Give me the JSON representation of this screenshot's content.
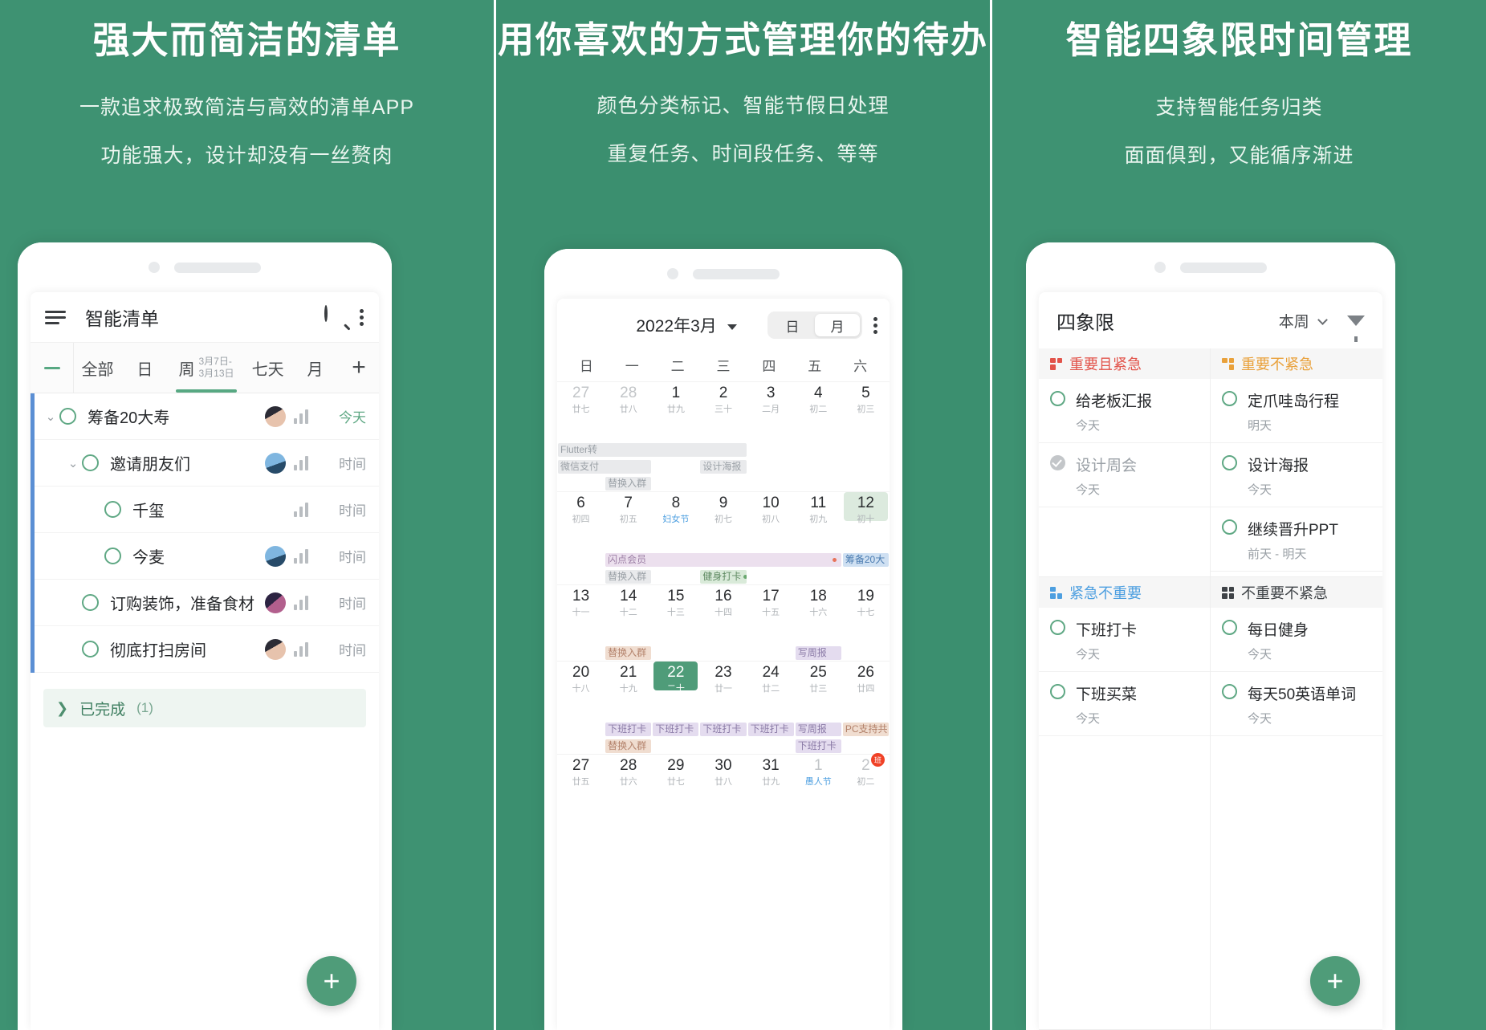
{
  "panels": [
    {
      "headline": "强大而简洁的清单",
      "sub1": "一款追求极致简洁与高效的清单APP",
      "sub2": "功能强大，设计却没有一丝赘肉"
    },
    {
      "headline": "用你喜欢的方式管理你的待办",
      "sub1": "颜色分类标记、智能节假日处理",
      "sub2": "重复任务、时间段任务、等等"
    },
    {
      "headline": "智能四象限时间管理",
      "sub1": "支持智能任务归类",
      "sub2": "面面俱到，又能循序渐进"
    }
  ],
  "colors": {
    "brand_green": "#3e9272",
    "accent_green": "#4f9c79",
    "circle_green": "#5fa884",
    "rail_blue": "#5b8fd4",
    "q1_red": "#e2534a",
    "q2_orange": "#e9a13b",
    "q3_blue": "#4d9fe0",
    "q4_gray": "#55585b"
  },
  "app1": {
    "menu_icon": "hamburger-icon",
    "title": "智能清单",
    "search_icon": "search-icon",
    "more_icon": "more-vertical-icon",
    "collapse_icon": "minus-icon",
    "add_tab_icon": "plus-icon",
    "tabs": [
      {
        "label": "全部",
        "range": "",
        "active": false
      },
      {
        "label": "日",
        "range": "",
        "active": false
      },
      {
        "label": "周",
        "range": "3月7日-\n3月13日",
        "range_line1": "3月7日-",
        "range_line2": "3月13日",
        "active": true
      },
      {
        "label": "七天",
        "range": "",
        "active": false
      },
      {
        "label": "月",
        "range": "",
        "active": false
      }
    ],
    "tasks": [
      {
        "name": "筹备20大寿",
        "due": "今天",
        "due_today": true,
        "indent": 0,
        "chevron": true,
        "avatar": "av-a",
        "has_avatar": true
      },
      {
        "name": "邀请朋友们",
        "due": "时间",
        "due_today": false,
        "indent": 1,
        "chevron": true,
        "avatar": "av-b",
        "has_avatar": true
      },
      {
        "name": "千玺",
        "due": "时间",
        "due_today": false,
        "indent": 2,
        "chevron": false,
        "avatar": "",
        "has_avatar": false
      },
      {
        "name": "今麦",
        "due": "时间",
        "due_today": false,
        "indent": 2,
        "chevron": false,
        "avatar": "av-b",
        "has_avatar": true
      },
      {
        "name": "订购装饰，准备食材",
        "due": "时间",
        "due_today": false,
        "indent": 1,
        "chevron": false,
        "avatar": "av-c",
        "has_avatar": true
      },
      {
        "name": "彻底打扫房间",
        "due": "时间",
        "due_today": false,
        "indent": 1,
        "chevron": false,
        "avatar": "av-a",
        "has_avatar": true
      }
    ],
    "completed": {
      "arrow_icon": "chevron-right-icon",
      "label": "已完成",
      "count": "(1)"
    },
    "fab_label": "+"
  },
  "app2": {
    "title": "2022年3月",
    "dropdown_icon": "caret-down-icon",
    "segments": [
      {
        "label": "日",
        "active": false
      },
      {
        "label": "月",
        "active": true
      }
    ],
    "more_icon": "more-vertical-icon",
    "weekdays": [
      "日",
      "一",
      "二",
      "三",
      "四",
      "五",
      "六"
    ],
    "weeks": [
      {
        "days": [
          {
            "num": "27",
            "lunar": "廿七",
            "muted": true
          },
          {
            "num": "28",
            "lunar": "廿八",
            "muted": true
          },
          {
            "num": "1",
            "lunar": "廿九",
            "muted": false
          },
          {
            "num": "2",
            "lunar": "三十",
            "muted": false
          },
          {
            "num": "3",
            "lunar": "二月",
            "muted": false
          },
          {
            "num": "4",
            "lunar": "初二",
            "muted": false
          },
          {
            "num": "5",
            "lunar": "初三",
            "muted": false
          }
        ],
        "event_rows": [
          [
            {
              "t": "Flutter转",
              "c": "gray",
              "span": 4
            },
            {
              "t": "",
              "c": "blank",
              "span": 3
            }
          ],
          [
            {
              "t": "微信支付",
              "c": "gray",
              "span": 2
            },
            {
              "t": "",
              "c": "blank",
              "span": 1
            },
            {
              "t": "设计海报",
              "c": "gray",
              "span": 1
            },
            {
              "t": "",
              "c": "blank",
              "span": 3
            }
          ],
          [
            {
              "t": "",
              "c": "blank",
              "span": 1
            },
            {
              "t": "替换入群",
              "c": "gray",
              "span": 1
            },
            {
              "t": "",
              "c": "blank",
              "span": 5
            }
          ]
        ]
      },
      {
        "days": [
          {
            "num": "6",
            "lunar": "初四",
            "muted": false
          },
          {
            "num": "7",
            "lunar": "初五",
            "muted": false
          },
          {
            "num": "8",
            "lunar": "妇女节",
            "muted": false,
            "festival": true
          },
          {
            "num": "9",
            "lunar": "初七",
            "muted": false
          },
          {
            "num": "10",
            "lunar": "初八",
            "muted": false
          },
          {
            "num": "11",
            "lunar": "初九",
            "muted": false
          },
          {
            "num": "12",
            "lunar": "初十",
            "muted": false,
            "selected": true
          }
        ],
        "event_rows": [
          [
            {
              "t": "",
              "c": "blank",
              "span": 1
            },
            {
              "t": "闪点会员",
              "c": "purple",
              "span": 5,
              "dot": "red"
            },
            {
              "t": "筹备20大",
              "c": "blue",
              "span": 1
            }
          ],
          [
            {
              "t": "",
              "c": "blank",
              "span": 1
            },
            {
              "t": "替换入群",
              "c": "gray",
              "span": 1
            },
            {
              "t": "",
              "c": "blank",
              "span": 1
            },
            {
              "t": "健身打卡",
              "c": "green",
              "span": 1,
              "dot": "green"
            },
            {
              "t": "",
              "c": "blank",
              "span": 3
            }
          ]
        ]
      },
      {
        "days": [
          {
            "num": "13",
            "lunar": "十一",
            "muted": false
          },
          {
            "num": "14",
            "lunar": "十二",
            "muted": false
          },
          {
            "num": "15",
            "lunar": "十三",
            "muted": false
          },
          {
            "num": "16",
            "lunar": "十四",
            "muted": false
          },
          {
            "num": "17",
            "lunar": "十五",
            "muted": false
          },
          {
            "num": "18",
            "lunar": "十六",
            "muted": false
          },
          {
            "num": "19",
            "lunar": "十七",
            "muted": false
          }
        ],
        "event_rows": [
          [
            {
              "t": "",
              "c": "blank",
              "span": 1
            },
            {
              "t": "替换入群",
              "c": "pink",
              "span": 1
            },
            {
              "t": "",
              "c": "blank",
              "span": 3
            },
            {
              "t": "写周报",
              "c": "lav",
              "span": 1
            },
            {
              "t": "",
              "c": "blank",
              "span": 1
            }
          ]
        ]
      },
      {
        "days": [
          {
            "num": "20",
            "lunar": "十八",
            "muted": false
          },
          {
            "num": "21",
            "lunar": "十九",
            "muted": false
          },
          {
            "num": "22",
            "lunar": "二十",
            "muted": false,
            "today": true
          },
          {
            "num": "23",
            "lunar": "廿一",
            "muted": false
          },
          {
            "num": "24",
            "lunar": "廿二",
            "muted": false
          },
          {
            "num": "25",
            "lunar": "廿三",
            "muted": false
          },
          {
            "num": "26",
            "lunar": "廿四",
            "muted": false
          }
        ],
        "event_rows": [
          [
            {
              "t": "",
              "c": "blank",
              "span": 1
            },
            {
              "t": "下班打卡",
              "c": "lav",
              "span": 1
            },
            {
              "t": "下班打卡",
              "c": "lav",
              "span": 1
            },
            {
              "t": "下班打卡",
              "c": "lav",
              "span": 1
            },
            {
              "t": "下班打卡",
              "c": "lav",
              "span": 1
            },
            {
              "t": "写周报",
              "c": "lav",
              "span": 1
            },
            {
              "t": "PC支持共",
              "c": "pink",
              "span": 1
            }
          ],
          [
            {
              "t": "",
              "c": "blank",
              "span": 1
            },
            {
              "t": "替换入群",
              "c": "pink",
              "span": 1
            },
            {
              "t": "",
              "c": "blank",
              "span": 3
            },
            {
              "t": "下班打卡",
              "c": "lav",
              "span": 1
            },
            {
              "t": "",
              "c": "blank",
              "span": 1
            }
          ]
        ]
      },
      {
        "days": [
          {
            "num": "27",
            "lunar": "廿五",
            "muted": false
          },
          {
            "num": "28",
            "lunar": "廿六",
            "muted": false
          },
          {
            "num": "29",
            "lunar": "廿七",
            "muted": false
          },
          {
            "num": "30",
            "lunar": "廿八",
            "muted": false
          },
          {
            "num": "31",
            "lunar": "廿九",
            "muted": false
          },
          {
            "num": "1",
            "lunar": "愚人节",
            "muted": true,
            "festival": true
          },
          {
            "num": "2",
            "lunar": "初二",
            "muted": true,
            "badge": "班"
          }
        ],
        "event_rows": []
      }
    ]
  },
  "app3": {
    "title": "四象限",
    "week_filter": "本周",
    "week_caret_icon": "chevron-down-icon",
    "filter_icon": "funnel-icon",
    "fab_label": "+",
    "quadrants": [
      {
        "name": "重要且紧急",
        "icon": "quadrant-icon-q1",
        "color": "#e2534a",
        "icon_cells": [
          "#e2534a",
          "#e2534a",
          "#e2534a",
          "transparent"
        ],
        "items": [
          {
            "name": "给老板汇报",
            "date": "今天",
            "done": false
          },
          {
            "name": "设计周会",
            "date": "今天",
            "done": true
          }
        ]
      },
      {
        "name": "重要不紧急",
        "icon": "quadrant-icon-q2",
        "color": "#e9a13b",
        "icon_cells": [
          "#e9a13b",
          "#e9a13b",
          "transparent",
          "#e9a13b"
        ],
        "items": [
          {
            "name": "定爪哇岛行程",
            "date": "明天",
            "done": false
          },
          {
            "name": "设计海报",
            "date": "今天",
            "done": false
          },
          {
            "name": "继续晋升PPT",
            "date": "前天 - 明天",
            "done": false
          }
        ]
      },
      {
        "name": "紧急不重要",
        "icon": "quadrant-icon-q3",
        "color": "#4d9fe0",
        "icon_cells": [
          "#4d9fe0",
          "transparent",
          "#4d9fe0",
          "#4d9fe0"
        ],
        "items": [
          {
            "name": "下班打卡",
            "date": "今天",
            "done": false
          },
          {
            "name": "下班买菜",
            "date": "今天",
            "done": false
          }
        ]
      },
      {
        "name": "不重要不紧急",
        "icon": "quadrant-icon-q4",
        "color": "#3f4347",
        "icon_cells": [
          "#3f4347",
          "#3f4347",
          "#3f4347",
          "#3f4347"
        ],
        "items": [
          {
            "name": "每日健身",
            "date": "今天",
            "done": false
          },
          {
            "name": "每天50英语单词",
            "date": "今天",
            "done": false
          }
        ]
      }
    ]
  }
}
